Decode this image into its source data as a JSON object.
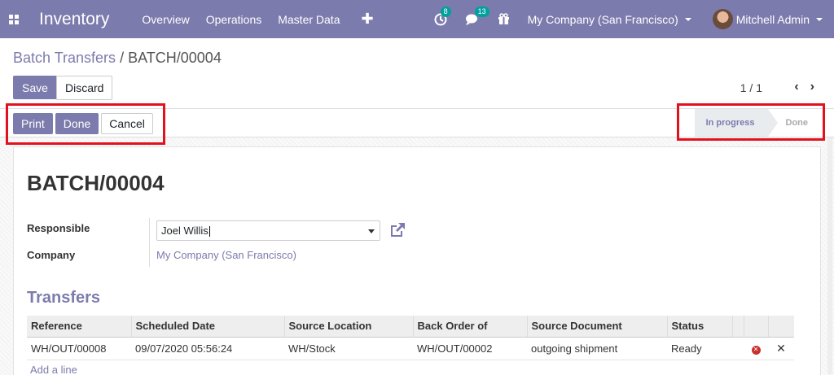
{
  "navbar": {
    "app_title": "Inventory",
    "menu": [
      "Overview",
      "Operations",
      "Master Data"
    ],
    "plus": "✚",
    "activity_badge": "8",
    "message_badge": "13",
    "company": "My Company (San Francisco)",
    "user": "Mitchell Admin"
  },
  "breadcrumb": {
    "parent": "Batch Transfers",
    "separator": "/",
    "current": "BATCH/00004"
  },
  "buttons": {
    "save": "Save",
    "discard": "Discard",
    "print": "Print",
    "done": "Done",
    "cancel": "Cancel"
  },
  "pager": {
    "value": "1 / 1",
    "prev": "‹",
    "next": "›"
  },
  "statusbar": {
    "stages": [
      "In progress",
      "Done"
    ],
    "current": "In progress"
  },
  "record": {
    "title": "BATCH/00004",
    "responsible_label": "Responsible",
    "responsible_value": "Joel Willis",
    "company_label": "Company",
    "company_value": "My Company (San Francisco)"
  },
  "transfers": {
    "section_title": "Transfers",
    "columns": [
      "Reference",
      "Scheduled Date",
      "Source Location",
      "Back Order of",
      "Source Document",
      "Status"
    ],
    "rows": [
      {
        "reference": "WH/OUT/00008",
        "scheduled_date": "09/07/2020 05:56:24",
        "source_location": "WH/Stock",
        "back_order_of": "WH/OUT/00002",
        "source_document": "outgoing shipment",
        "status": "Ready"
      }
    ],
    "add_line": "Add a line"
  },
  "colors": {
    "brand": "#7c7bad",
    "highlight": "#e3111e"
  }
}
